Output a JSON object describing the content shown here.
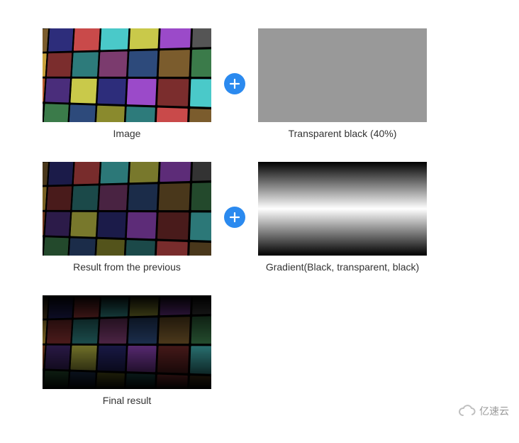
{
  "captions": {
    "row1_left": "Image",
    "row1_right": "Transparent black (40%)",
    "row2_left": "Result from the previous",
    "row2_right": "Gradient(Black, transparent, black)",
    "row3_left": "Final result"
  },
  "colors": {
    "plus_badge": "#2b8aef",
    "plus_icon": "#ffffff",
    "watermark": "#9a9a9a"
  },
  "overlays": {
    "solid_black_opacity": 0.4,
    "gradient_stops": [
      "black",
      "transparent",
      "black"
    ]
  },
  "watermark_text": "亿速云"
}
